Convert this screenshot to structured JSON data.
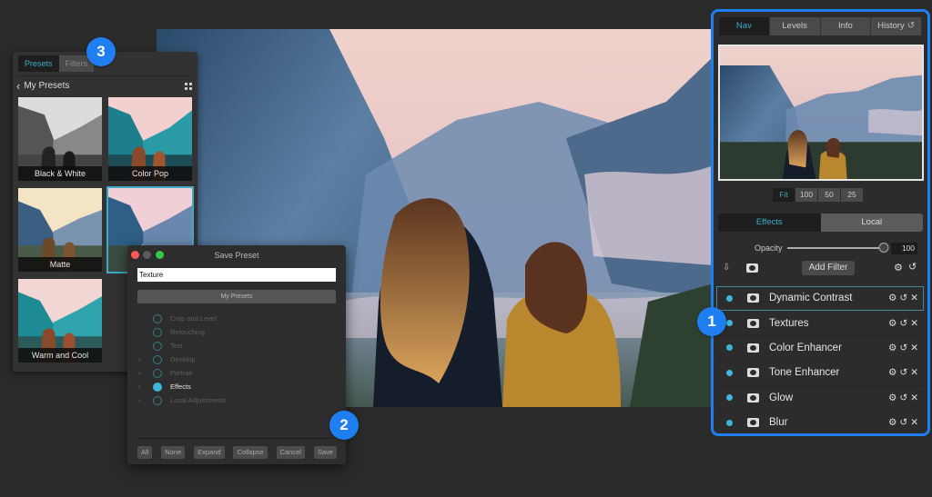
{
  "colors": {
    "accent_blue": "#1f7ef0",
    "active_teal": "#3fa9c8",
    "dot_cyan": "#3fb6d9",
    "background": "#2a2a2a"
  },
  "presets_panel": {
    "tabs": [
      {
        "label": "Presets",
        "active": true
      },
      {
        "label": "Filters",
        "active": false
      }
    ],
    "title": "My Presets",
    "back_icon": "chevron-left-icon",
    "view_icon": "grid-view-icon",
    "presets": [
      {
        "label": "Black & White",
        "selected": false
      },
      {
        "label": "Color Pop",
        "selected": false
      },
      {
        "label": "Matte",
        "selected": false
      },
      {
        "label": "",
        "selected": true
      },
      {
        "label": "Warm and Cool",
        "selected": false
      }
    ]
  },
  "save_dialog": {
    "title": "Save Preset",
    "name_value": "Texture",
    "folder_label": "My Presets",
    "categories": [
      {
        "label": "Crop and Level",
        "expandable": false,
        "checked": false
      },
      {
        "label": "Retouching",
        "expandable": false,
        "checked": false
      },
      {
        "label": "Text",
        "expandable": false,
        "checked": false
      },
      {
        "label": "Develop",
        "expandable": true,
        "checked": false
      },
      {
        "label": "Portrait",
        "expandable": true,
        "checked": false
      },
      {
        "label": "Effects",
        "expandable": true,
        "checked": true
      },
      {
        "label": "Local Adjustments",
        "expandable": true,
        "checked": false
      }
    ],
    "buttons": {
      "all": "All",
      "none": "None",
      "expand": "Expand",
      "collapse": "Collapse",
      "cancel": "Cancel",
      "save": "Save"
    }
  },
  "right_panel": {
    "tabs": [
      {
        "label": "Nav",
        "active": true
      },
      {
        "label": "Levels",
        "active": false
      },
      {
        "label": "Info",
        "active": false
      },
      {
        "label": "History",
        "active": false
      }
    ],
    "history_icon": "↺",
    "zoom_options": [
      {
        "label": "Fit",
        "active": true
      },
      {
        "label": "100",
        "active": false
      },
      {
        "label": "50",
        "active": false
      },
      {
        "label": "25",
        "active": false
      }
    ],
    "mode_tabs": [
      {
        "label": "Effects",
        "active": true
      },
      {
        "label": "Local",
        "active": false
      }
    ],
    "opacity": {
      "label": "Opacity",
      "value": "100",
      "fraction": 1.0
    },
    "add_filter_label": "Add Filter",
    "filters": [
      {
        "name": "Dynamic Contrast",
        "selected": true
      },
      {
        "name": "Textures",
        "selected": false
      },
      {
        "name": "Color Enhancer",
        "selected": false
      },
      {
        "name": "Tone Enhancer",
        "selected": false
      },
      {
        "name": "Glow",
        "selected": false
      },
      {
        "name": "Blur",
        "selected": false
      }
    ],
    "action_glyphs": {
      "settings": "⚙",
      "reset": "↺",
      "remove": "✕",
      "export": "⇩"
    }
  },
  "badges": [
    "1",
    "2",
    "3"
  ]
}
